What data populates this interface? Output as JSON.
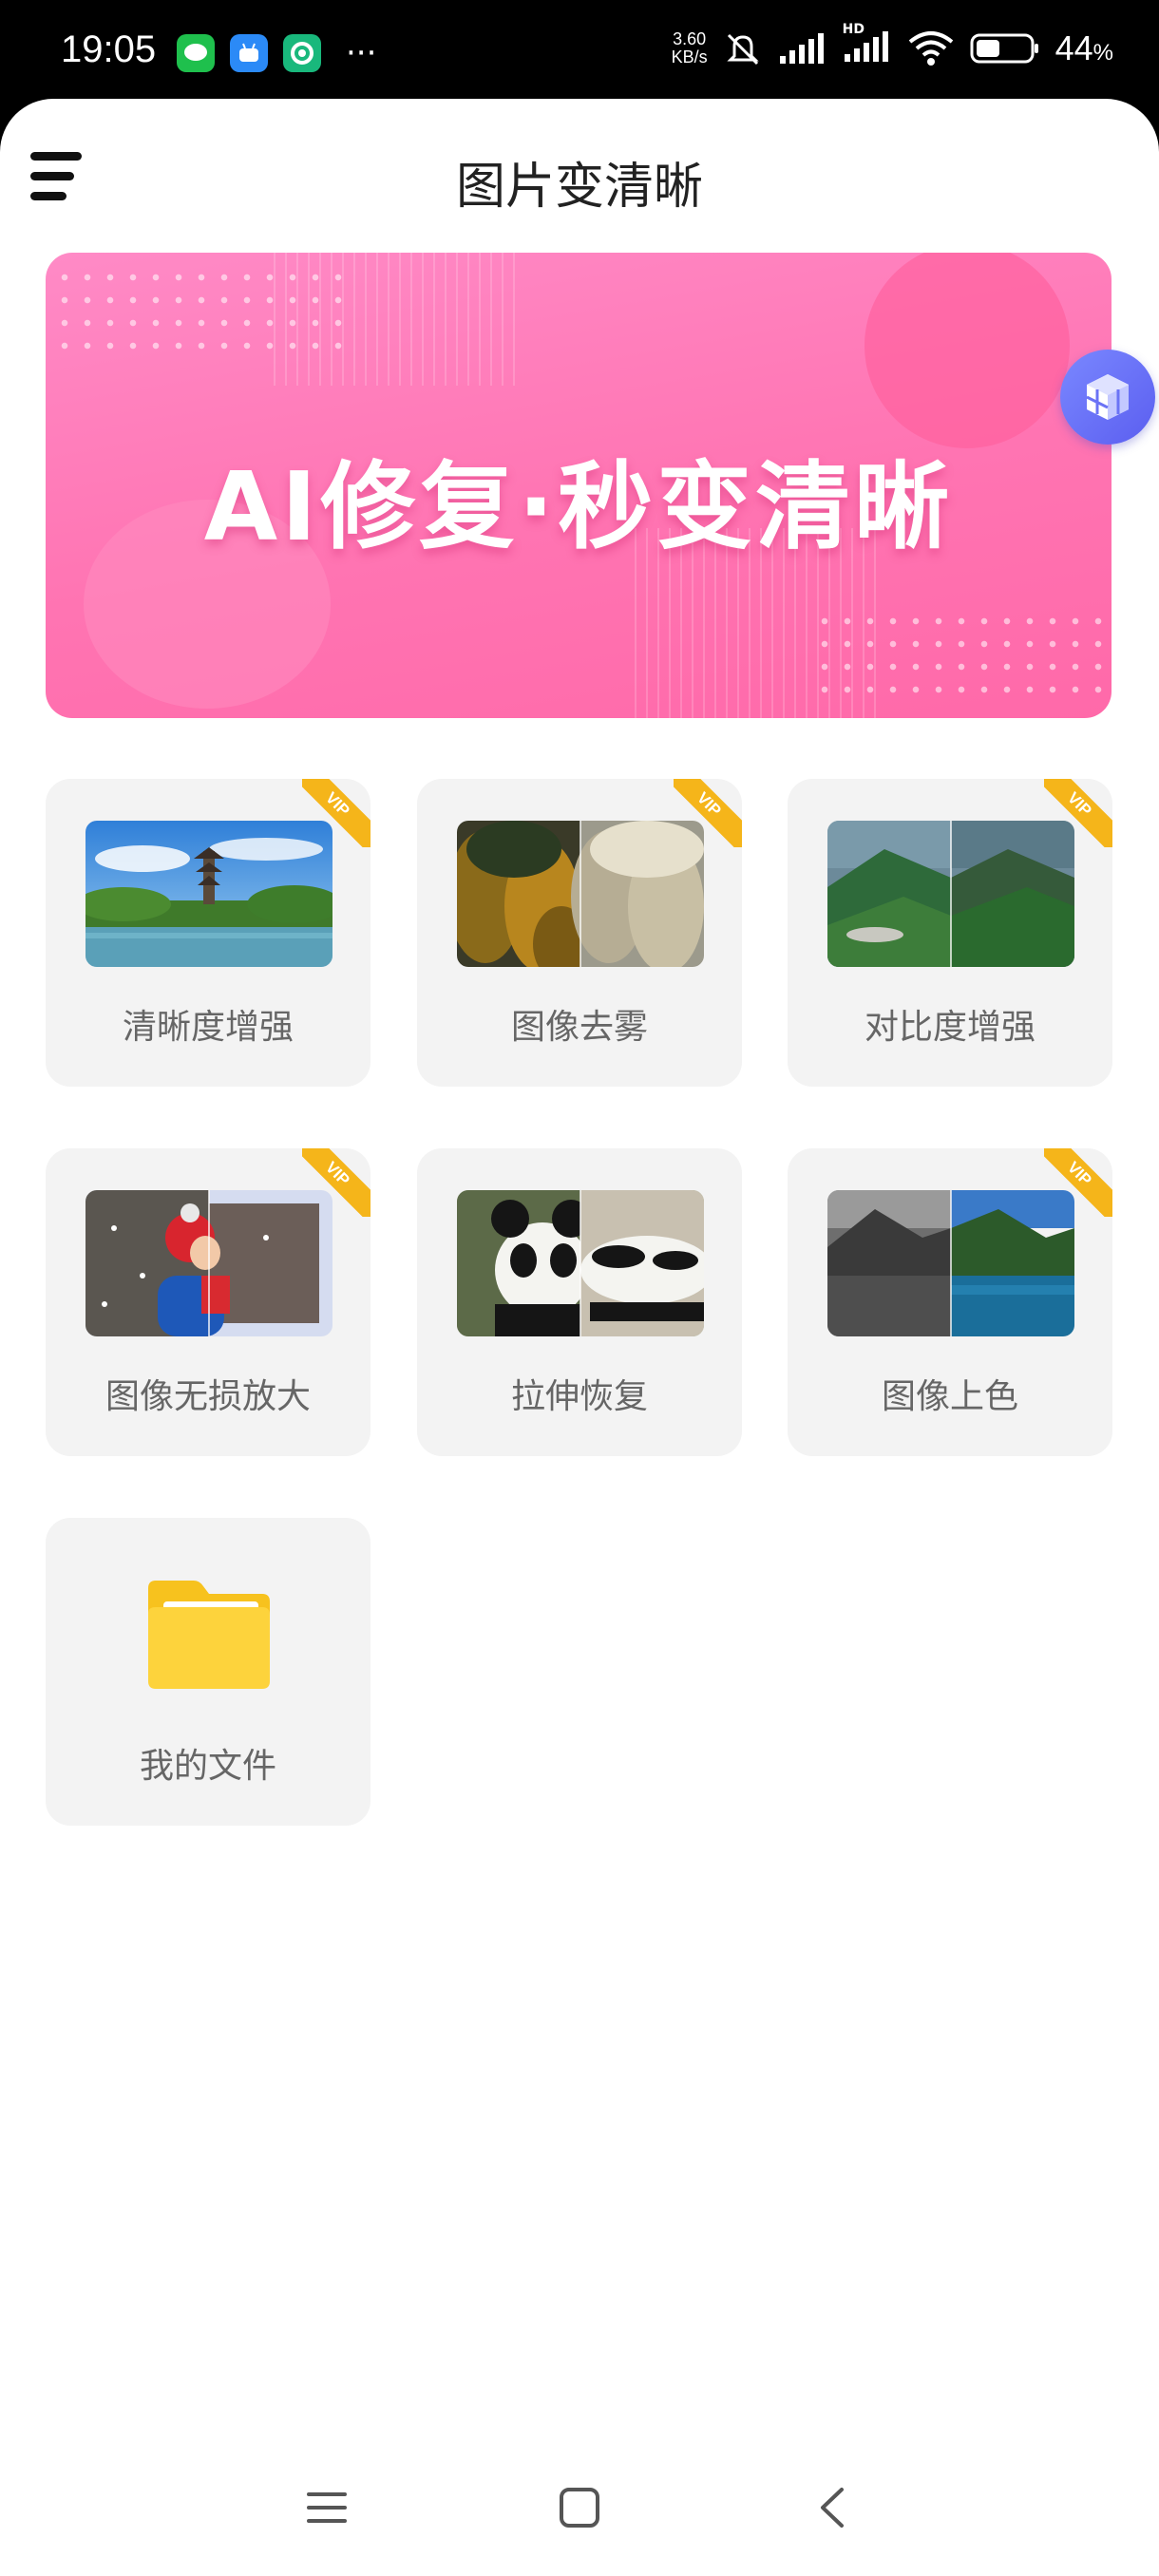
{
  "status_bar": {
    "time": "19:05",
    "speed_value": "3.60",
    "speed_unit": "KB/s",
    "network_label": "HD",
    "battery_value": "44",
    "battery_unit": "%",
    "battery_level": 0.44
  },
  "header": {
    "title": "图片变清晰"
  },
  "banner": {
    "text": "AI修复·秒变清晰"
  },
  "tools": [
    {
      "label": "清晰度增强",
      "vip": true,
      "vip_text": "VIP"
    },
    {
      "label": "图像去雾",
      "vip": true,
      "vip_text": "VIP"
    },
    {
      "label": "对比度增强",
      "vip": true,
      "vip_text": "VIP"
    },
    {
      "label": "图像无损放大",
      "vip": true,
      "vip_text": "VIP"
    },
    {
      "label": "拉伸恢复",
      "vip": false
    },
    {
      "label": "图像上色",
      "vip": true,
      "vip_text": "VIP"
    },
    {
      "label": "我的文件",
      "vip": false
    }
  ],
  "colors": {
    "banner_pink": "#ff74b2",
    "vip_gold": "#f5b51a",
    "tile_bg": "#f3f3f3",
    "float_button": "#6b73f5",
    "folder_yellow": "#fdd33c"
  }
}
